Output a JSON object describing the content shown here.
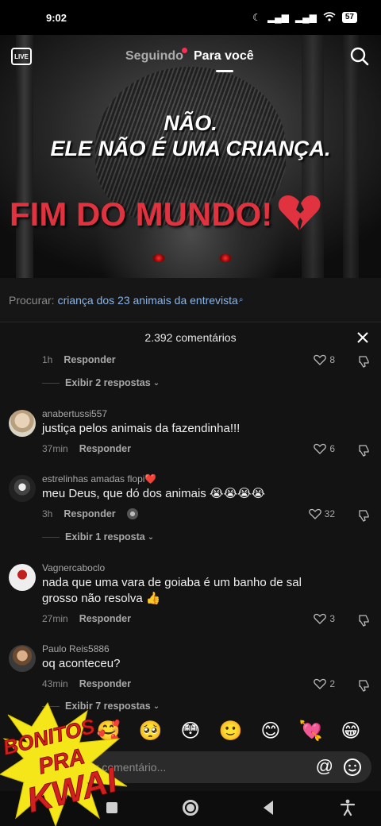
{
  "status_bar": {
    "time": "9:02",
    "battery": "57"
  },
  "top_nav": {
    "live_label": "LIVE",
    "tabs": [
      {
        "label": "Seguindo",
        "active": false,
        "has_dot": true
      },
      {
        "label": "Para você",
        "active": true
      }
    ]
  },
  "video": {
    "caption_line1": "NÃO.",
    "caption_line2": "ELE NÃO É UMA CRIANÇA.",
    "headline": "FIM DO MUNDO!",
    "headline_color": "#e0323f"
  },
  "search_suggestion": {
    "prefix": "Procurar:",
    "term": "criança dos 23 animais da entrevista"
  },
  "comments_panel": {
    "count_label": "2.392 comentários",
    "comments": [
      {
        "user": "",
        "text": "",
        "time": "1h",
        "reply_label": "Responder",
        "likes": "8",
        "replies_label": "Exibir 2 respostas"
      },
      {
        "user": "anabertussi557",
        "text": "justiça pelos animais da fazendinha!!!",
        "time": "37min",
        "reply_label": "Responder",
        "likes": "6"
      },
      {
        "user": "estrelinhas amadas flopi",
        "user_emoji": "❤️",
        "text": "meu Deus, que dó dos animais 😭😭😭😭",
        "time": "3h",
        "reply_label": "Responder",
        "likes": "32",
        "replies_label": "Exibir 1 resposta"
      },
      {
        "user": "Vagnercaboclo",
        "text": "nada que uma vara de goiaba é um banho de sal grosso não resolva 👍",
        "time": "27min",
        "reply_label": "Responder",
        "likes": "3"
      },
      {
        "user": "Paulo Reis5886",
        "text": "oq aconteceu?",
        "time": "43min",
        "reply_label": "Responder",
        "likes": "2",
        "replies_label": "Exibir 7 respostas"
      }
    ]
  },
  "emoji_bar": [
    "🥰",
    "🥺",
    "😳",
    "🙂",
    "😊",
    "💘",
    "😁"
  ],
  "comment_input": {
    "placeholder": "Adicionar comentário...",
    "visible_placeholder": "ar comentário..."
  },
  "watermark": {
    "line1": "BONITOS",
    "line2": "PRA",
    "line3": "KWAI"
  }
}
